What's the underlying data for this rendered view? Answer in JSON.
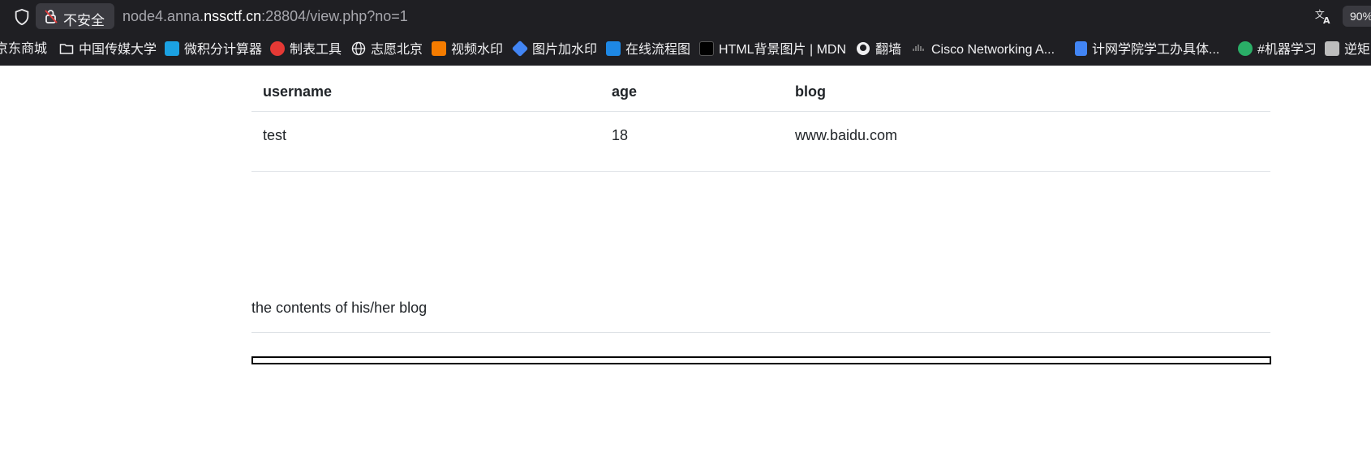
{
  "addressbar": {
    "insecure_label": "不安全",
    "url_prefix": "node4.anna.",
    "url_host": "nssctf.cn",
    "url_suffix": ":28804/view.php?no=1",
    "zoom": "90%"
  },
  "bookmarks": [
    {
      "label": "京东商城",
      "icon": "jd-icon",
      "color": "#e1251b"
    },
    {
      "label": "中国传媒大学",
      "icon": "folder-icon",
      "color": "#f0f0f2"
    },
    {
      "label": "微积分计算器",
      "icon": "calculator-icon",
      "color": "#1ba1e2"
    },
    {
      "label": "制表工具",
      "icon": "table-tool-icon",
      "color": "#e53935"
    },
    {
      "label": "志愿北京",
      "icon": "globe-icon",
      "color": "#f0f0f2"
    },
    {
      "label": "视频水印",
      "icon": "video-watermark-icon",
      "color": "#f57c00"
    },
    {
      "label": "图片加水印",
      "icon": "image-watermark-icon",
      "color": "#4285f4"
    },
    {
      "label": "在线流程图",
      "icon": "flowchart-icon",
      "color": "#1e88e5"
    },
    {
      "label": "HTML背景图片 | MDN",
      "icon": "mdn-icon",
      "color": "#000000"
    },
    {
      "label": "翻墙",
      "icon": "github-icon",
      "color": "#f0f0f2"
    },
    {
      "label": "Cisco Networking A...",
      "icon": "cisco-icon",
      "color": "#9e9e9e"
    },
    {
      "label": "计网学院学工办具体...",
      "icon": "doc-icon",
      "color": "#4285f4"
    },
    {
      "label": "#机器学习",
      "icon": "wechat-icon",
      "color": "#2aae67"
    },
    {
      "label": "逆矩",
      "icon": "r-icon",
      "color": "#bdbdbd"
    }
  ],
  "table": {
    "headers": [
      "username",
      "age",
      "blog"
    ],
    "rows": [
      [
        "test",
        "18",
        "www.baidu.com"
      ]
    ]
  },
  "blog_caption": "the contents of his/her blog"
}
